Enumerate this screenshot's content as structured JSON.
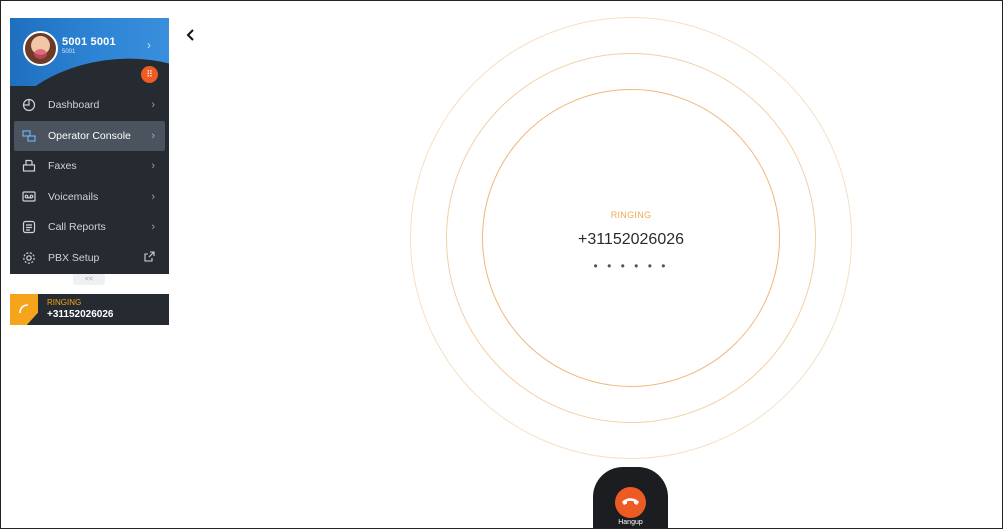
{
  "profile": {
    "name": "5001 5001",
    "extension": "5001"
  },
  "sidebar": {
    "items": [
      {
        "label": "Dashboard",
        "icon": "dashboard-icon"
      },
      {
        "label": "Operator Console",
        "icon": "operator-console-icon",
        "active": true
      },
      {
        "label": "Faxes",
        "icon": "fax-icon"
      },
      {
        "label": "Voicemails",
        "icon": "voicemail-icon"
      },
      {
        "label": "Call Reports",
        "icon": "call-reports-icon"
      },
      {
        "label": "PBX Setup",
        "icon": "gear-icon"
      }
    ],
    "collapse_label": "<<"
  },
  "ringing_card": {
    "status": "RINGING",
    "number": "+31152026026"
  },
  "call": {
    "status": "RINGING",
    "number": "+31152026026",
    "dots": "• • • • • •"
  },
  "hangup": {
    "label": "Hangup"
  },
  "colors": {
    "accent_orange": "#f05a23",
    "ringing_yellow": "#f5a51b",
    "sidebar_bg": "#262b32",
    "profile_blue": "#2f86d6"
  }
}
